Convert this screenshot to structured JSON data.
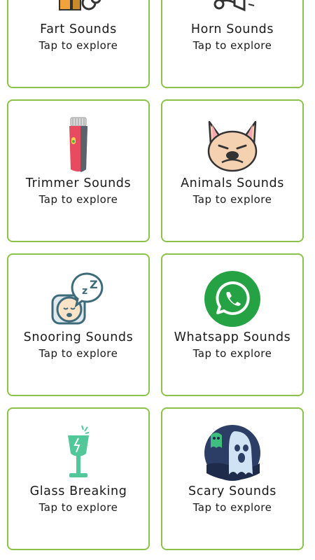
{
  "theme": {
    "card_border": "#8bc34a",
    "text": "#1a1a1a",
    "background": "#ffffff"
  },
  "cards": [
    {
      "title": "Fart Sounds",
      "subtitle": "Tap to explore",
      "icon": "fart-icon"
    },
    {
      "title": "Horn Sounds",
      "subtitle": "Tap to explore",
      "icon": "horn-icon"
    },
    {
      "title": "Trimmer Sounds",
      "subtitle": "Tap to explore",
      "icon": "trimmer-icon"
    },
    {
      "title": "Animals Sounds",
      "subtitle": "Tap to explore",
      "icon": "dog-face-icon"
    },
    {
      "title": "Snooring Sounds",
      "subtitle": "Tap to explore",
      "icon": "snoring-face-icon"
    },
    {
      "title": "Whatsapp Sounds",
      "subtitle": "Tap to explore",
      "icon": "whatsapp-icon"
    },
    {
      "title": "Glass Breaking",
      "subtitle": "Tap to explore",
      "icon": "broken-glass-icon"
    },
    {
      "title": "Scary Sounds",
      "subtitle": "Tap to explore",
      "icon": "ghost-icon"
    }
  ]
}
